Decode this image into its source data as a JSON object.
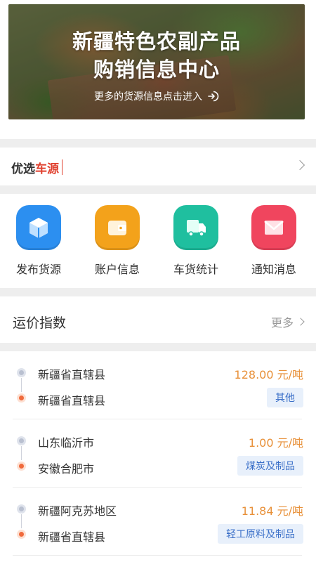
{
  "banner": {
    "title_line1": "新疆特色农副产品",
    "title_line2": "购销信息中心",
    "subtitle": "更多的货源信息点击进入"
  },
  "featured": {
    "title_part1": "优选",
    "title_part2": "车源"
  },
  "actions": [
    {
      "label": "发布货源",
      "icon": "cube-icon",
      "color": "#2c8ff0"
    },
    {
      "label": "账户信息",
      "icon": "wallet-icon",
      "color": "#f3a21b"
    },
    {
      "label": "车货统计",
      "icon": "truck-icon",
      "color": "#1fbf9f"
    },
    {
      "label": "通知消息",
      "icon": "mail-icon",
      "color": "#f0455e"
    }
  ],
  "freight_index": {
    "title": "运价指数",
    "more": "更多"
  },
  "routes": [
    {
      "origin": "新疆省直辖县",
      "destination": "新疆省直辖县",
      "price": "128.00 元/吨",
      "category": "其他"
    },
    {
      "origin": "山东临沂市",
      "destination": "安徽合肥市",
      "price": "1.00 元/吨",
      "category": "煤炭及制品"
    },
    {
      "origin": "新疆阿克苏地区",
      "destination": "新疆省直辖县",
      "price": "11.84 元/吨",
      "category": "轻工原料及制品"
    }
  ],
  "colors": {
    "accent_red": "#e0412f",
    "price_orange": "#e8913a",
    "tag_blue": "#3a6fc8"
  }
}
